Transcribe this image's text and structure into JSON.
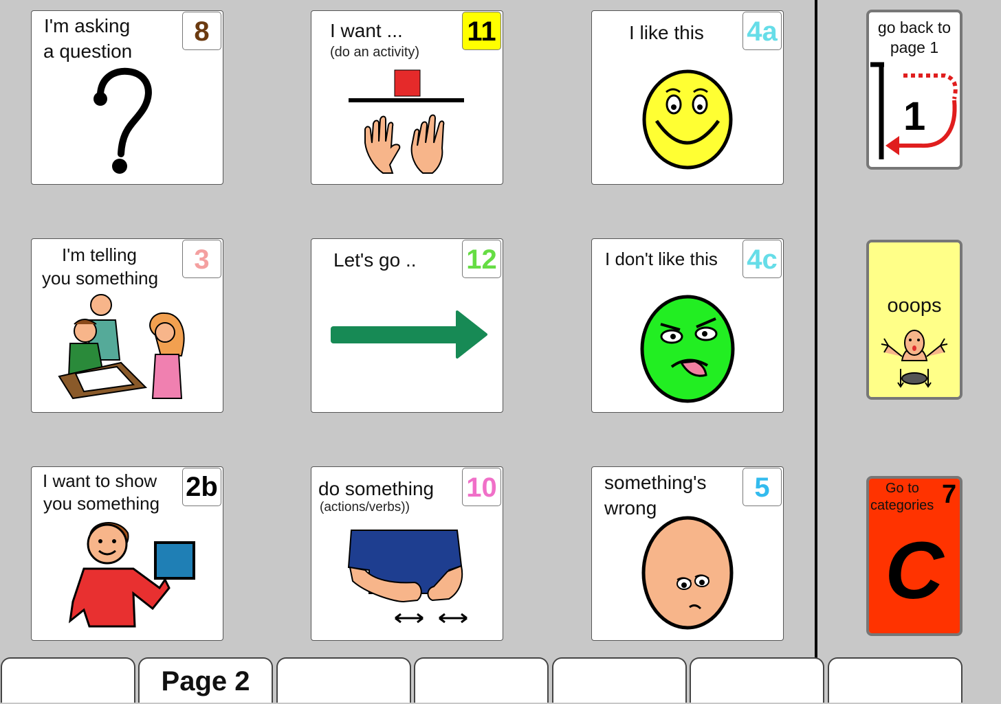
{
  "cells": [
    {
      "label1": "I'm asking",
      "label2": "a question",
      "badge": "8",
      "badge_color": "#6b3a10",
      "badge_bg": "#ffffff"
    },
    {
      "label1": "I want ...",
      "sub": "(do an activity)",
      "badge": "11",
      "badge_color": "#000000",
      "badge_bg": "#ffff00"
    },
    {
      "label1": "I like this",
      "badge": "4a",
      "badge_color": "#66dde8",
      "badge_bg": "#ffffff"
    },
    {
      "label1": "I'm telling",
      "label2": "you something",
      "badge": "3",
      "badge_color": "#f4a0a0",
      "badge_bg": "#ffffff"
    },
    {
      "label1": "Let's go ..",
      "badge": "12",
      "badge_color": "#66dd44",
      "badge_bg": "#ffffff"
    },
    {
      "label1": "I don't like this",
      "badge": "4c",
      "badge_color": "#66dde8",
      "badge_bg": "#ffffff"
    },
    {
      "label1": "I want to show",
      "label2": "you something",
      "badge": "2b",
      "badge_color": "#000000",
      "badge_bg": "#ffffff"
    },
    {
      "label1": "do something",
      "sub": "(actions/verbs))",
      "badge": "10",
      "badge_color": "#f070c8",
      "badge_bg": "#ffffff"
    },
    {
      "label1": "something's",
      "label2": "wrong",
      "badge": "5",
      "badge_color": "#33bbee",
      "badge_bg": "#ffffff"
    }
  ],
  "side": {
    "back": {
      "label1": "go back to",
      "label2": "page 1",
      "number": "1"
    },
    "oops": {
      "label": "ooops",
      "bg": "#ffff88"
    },
    "categories": {
      "label1": "Go to",
      "label2": "categories",
      "badge": "7",
      "letter": "C",
      "bg": "#ff3300"
    }
  },
  "tabs": [
    "",
    "Page 2",
    "",
    "",
    "",
    "",
    ""
  ],
  "icons": [
    "question-mark-icon",
    "activity-icon",
    "happy-face-icon",
    "telling-people-icon",
    "arrow-right-icon",
    "disgusted-face-icon",
    "showing-person-icon",
    "hands-action-icon",
    "unwell-face-icon",
    "go-back-icon",
    "oops-person-icon",
    "categories-c-icon"
  ]
}
